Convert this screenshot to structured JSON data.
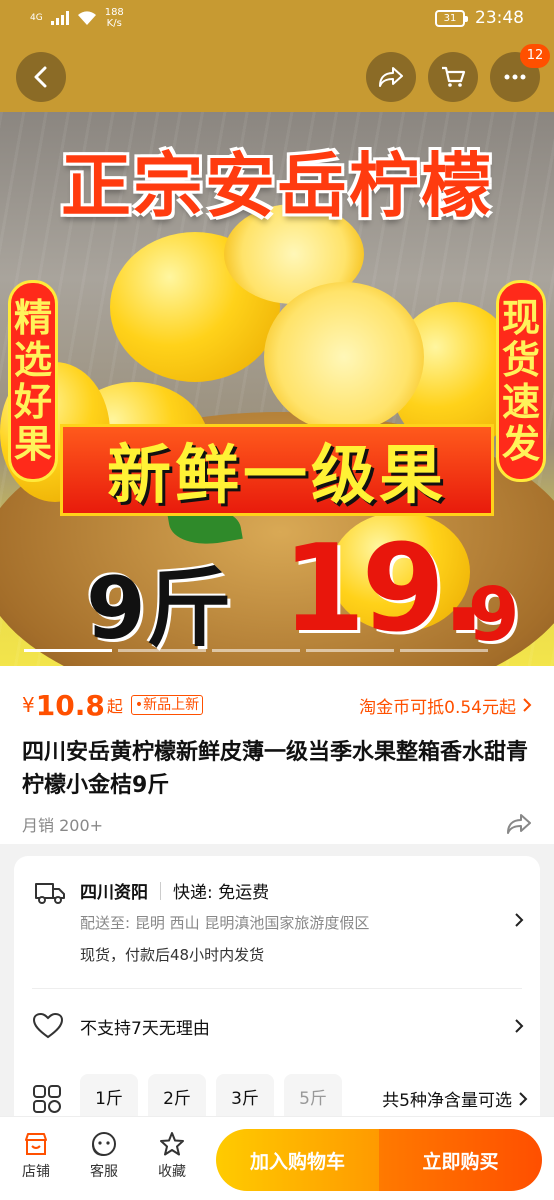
{
  "status_bar": {
    "network": "4G",
    "speed_value": "188",
    "speed_unit": "K/s",
    "battery": "31",
    "time": "23:48"
  },
  "nav": {
    "cart_badge": "12"
  },
  "hero": {
    "title": "正宗安岳柠檬",
    "left_tag": "精选好果",
    "right_tag": "现货速发",
    "banner": "新鲜一级果",
    "price_qty": "9斤",
    "price_main": "19.",
    "price_decimal": "9",
    "slide_count": 5,
    "active_slide": 1
  },
  "product": {
    "currency": "¥",
    "price": "10.8",
    "price_suffix": "起",
    "new_tag": "•新品上新",
    "coin_text": "淘金币可抵0.54元起",
    "title": "四川安岳黄柠檬新鲜皮薄一级当季水果整箱香水甜青柠檬小金桔9斤",
    "monthly_sales": "月销 200+"
  },
  "delivery": {
    "origin": "四川资阳",
    "express": "快递: 免运费",
    "address": "配送至: 昆明 西山 昆明滇池国家旅游度假区",
    "ship_note": "现货，付款后48小时内发货"
  },
  "returns": {
    "text": "不支持7天无理由"
  },
  "spec": {
    "options": [
      "1斤",
      "2斤",
      "3斤",
      "5斤"
    ],
    "more": "共5种净含量可选"
  },
  "bottom_bar": {
    "shop": "店铺",
    "service": "客服",
    "favorite": "收藏",
    "add_cart": "加入购物车",
    "buy_now": "立即购买"
  },
  "colors": {
    "accent": "#ff5000",
    "header_bg": "#c79a32"
  }
}
